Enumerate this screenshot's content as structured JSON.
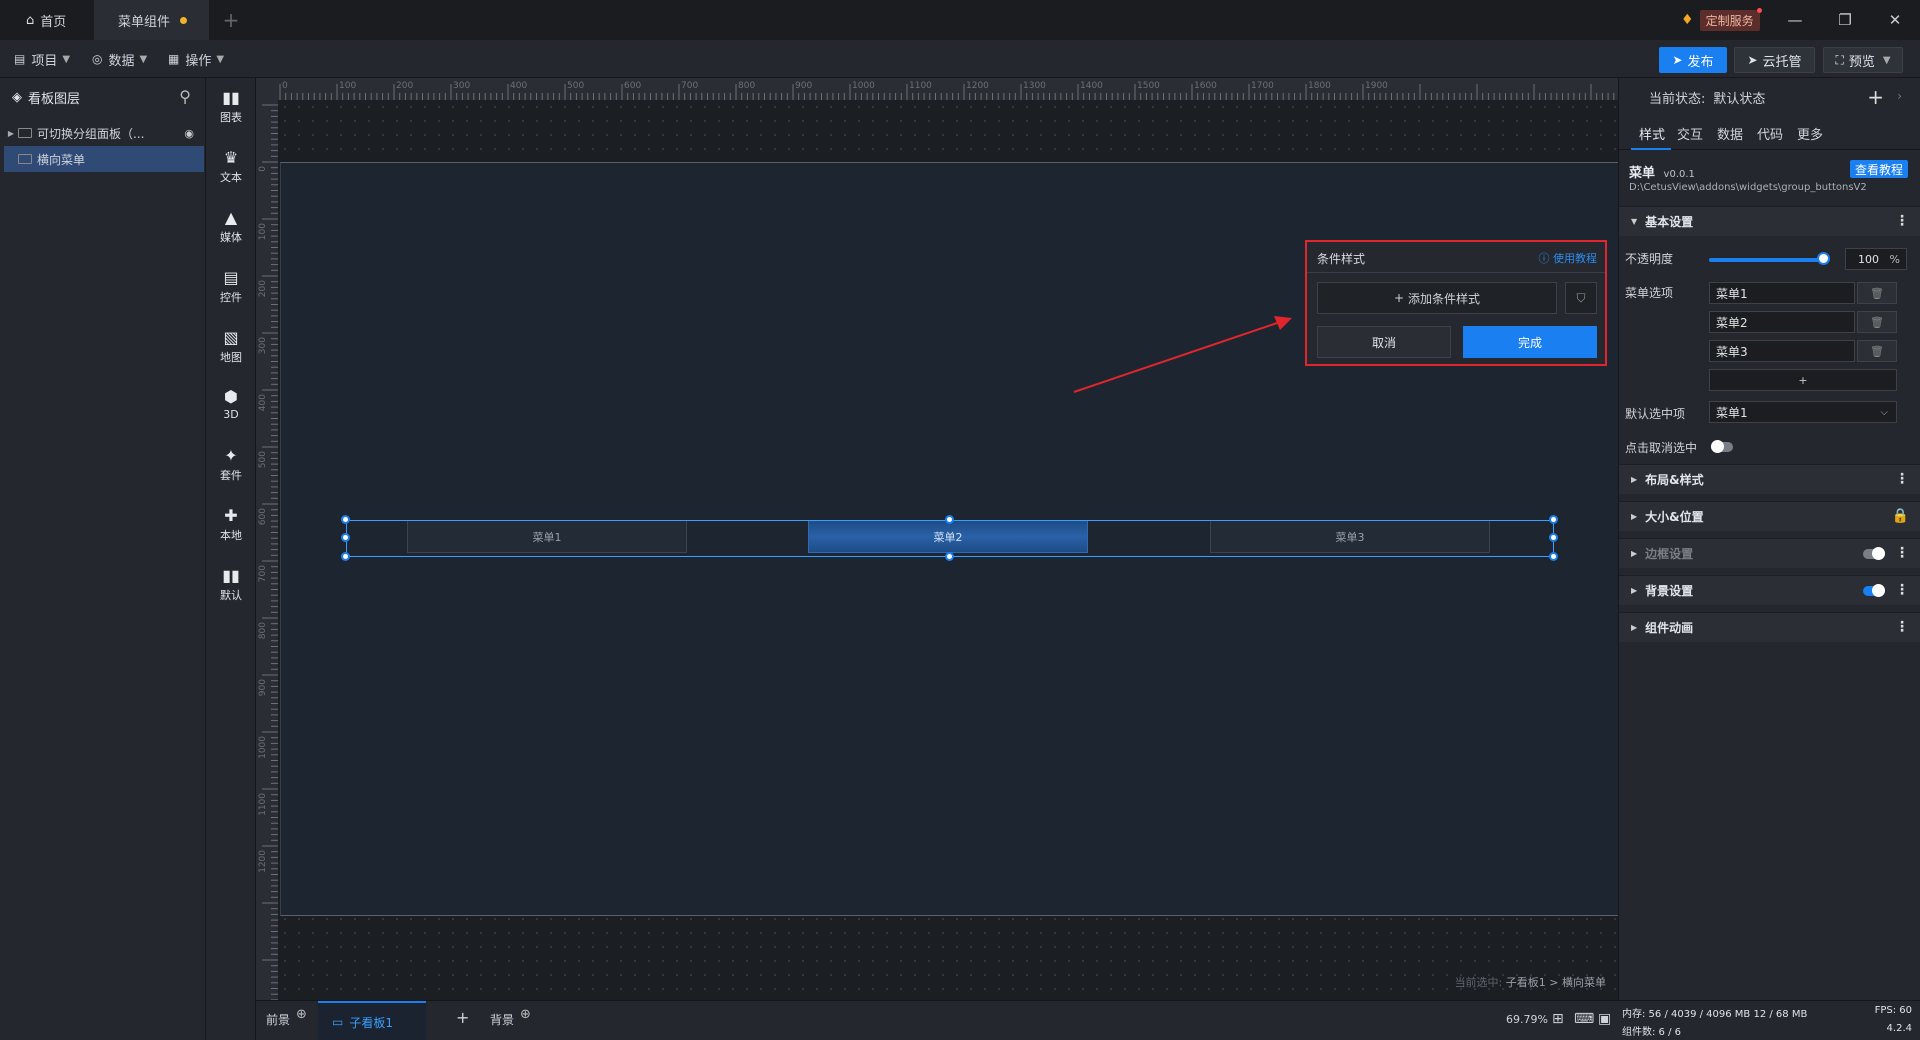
{
  "titlebar": {
    "tabs": [
      {
        "label": "首页",
        "icon": "home-icon"
      },
      {
        "label": "菜单组件",
        "icon": ""
      }
    ],
    "custom_service": "定制服务",
    "window_buttons": {
      "minimize": "—",
      "restore": "❐",
      "close": "✕"
    }
  },
  "toolbar": {
    "menus": [
      {
        "label": "项目",
        "icon": "file-icon"
      },
      {
        "label": "数据",
        "icon": "database-icon"
      },
      {
        "label": "操作",
        "icon": "grid-icon"
      }
    ],
    "publish": "发布",
    "cloud": "云托管",
    "preview": "预览"
  },
  "layers": {
    "title": "看板图层",
    "items": [
      {
        "label": "可切换分组面板（..."
      },
      {
        "label": "横向菜单"
      }
    ]
  },
  "components": [
    {
      "label": "图表",
      "icon": "chart-icon"
    },
    {
      "label": "文本",
      "icon": "text-icon"
    },
    {
      "label": "媒体",
      "icon": "media-icon"
    },
    {
      "label": "控件",
      "icon": "control-icon"
    },
    {
      "label": "地图",
      "icon": "map-icon"
    },
    {
      "label": "3D",
      "icon": "cube-icon"
    },
    {
      "label": "套件",
      "icon": "shirt-icon"
    },
    {
      "label": "本地",
      "icon": "puzzle-icon"
    },
    {
      "label": "默认",
      "icon": "bar-chart-icon"
    }
  ],
  "ruler": {
    "top_ticks": [
      "0",
      "100",
      "200",
      "300",
      "400",
      "500",
      "600",
      "700",
      "800",
      "900",
      "1000",
      "1100",
      "1200",
      "1300",
      "1400",
      "1500",
      "1600",
      "1700",
      "1800",
      "1900"
    ],
    "left_ticks": [
      "0",
      "100",
      "200",
      "300",
      "400",
      "500",
      "600",
      "700",
      "800",
      "900",
      "1000",
      "1100",
      "1200"
    ]
  },
  "canvas": {
    "menu_items": [
      "菜单1",
      "菜单2",
      "菜单3"
    ],
    "selected_index": 1,
    "current_selection_label": "当前选中:",
    "current_selection_path": "子看板1 > 横向菜单"
  },
  "condition_popup": {
    "title": "条件样式",
    "help": "使用教程",
    "add_label": "添加条件样式",
    "cancel": "取消",
    "done": "完成"
  },
  "props": {
    "state_label": "当前状态:",
    "state_value": "默认状态",
    "tabs": [
      "样式",
      "交互",
      "数据",
      "代码",
      "更多"
    ],
    "widget_name": "菜单",
    "widget_version": "v0.0.1",
    "widget_path": "D:\\CetusView\\addons\\widgets\\group_buttonsV2",
    "tutorial": "查看教程",
    "sections": {
      "basic": "基本设置",
      "layout": "布局&样式",
      "size": "大小&位置",
      "border": "边框设置",
      "background": "背景设置",
      "animation": "组件动画"
    },
    "opacity_label": "不透明度",
    "opacity_value": "100",
    "opacity_unit": "%",
    "menu_options_label": "菜单选项",
    "menu_options": [
      "菜单1",
      "菜单2",
      "菜单3"
    ],
    "add_option": "+",
    "default_label": "默认选中项",
    "default_value": "菜单1",
    "click_cancel_label": "点击取消选中",
    "click_cancel_on": false,
    "border_on": false,
    "background_on": true
  },
  "bottom": {
    "foreground": "前景",
    "sub_board": "子看板1",
    "add": "+",
    "background": "背景",
    "zoom": "69.79%"
  },
  "status": {
    "memory": "内存: 56 / 4039 / 4096 MB  12 / 68 MB",
    "fps": "FPS: 60",
    "count": "组件数: 6 / 6",
    "version": "4.2.4"
  },
  "colors": {
    "accent": "#1a7ff0",
    "highlight_border": "#e0262c"
  }
}
